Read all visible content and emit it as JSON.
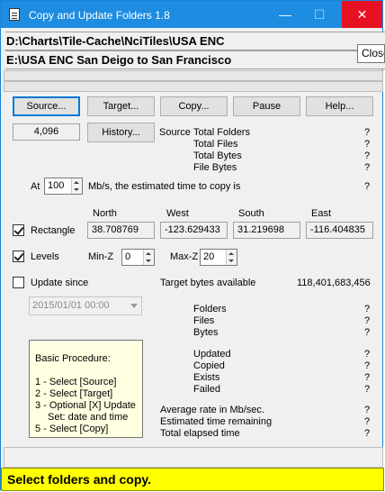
{
  "window": {
    "title": "Copy and Update Folders 1.8",
    "minimize": "—",
    "maximize": "☐",
    "close": "✕"
  },
  "paths": {
    "source": "D:\\Charts\\Tile-Cache\\NciTiles\\USA ENC",
    "target": "E:\\USA ENC San Deigo to San Francisco"
  },
  "tooltip": "Close",
  "buttons": {
    "source": "Source...",
    "target": "Target...",
    "copy": "Copy...",
    "pause": "Pause",
    "help": "Help...",
    "history": "History..."
  },
  "history_count": "4,096",
  "source_info": {
    "header": "Source",
    "labels": [
      "Total Folders",
      "Total Files",
      "Total Bytes",
      "File Bytes"
    ],
    "values": [
      "?",
      "?",
      "?",
      "?"
    ]
  },
  "rate": {
    "prefix": "At",
    "value": "100",
    "suffix": "Mb/s, the estimated time to copy is",
    "result": "?"
  },
  "rectangle": {
    "label": "Rectangle",
    "checked": true,
    "headers": [
      "North",
      "West",
      "South",
      "East"
    ],
    "values": [
      "38.708769",
      "-123.629433",
      "31.219698",
      "-116.404835"
    ]
  },
  "levels": {
    "label": "Levels",
    "checked": true,
    "min_label": "Min-Z",
    "min_value": "0",
    "max_label": "Max-Z",
    "max_value": "20"
  },
  "update_since": {
    "label": "Update since",
    "checked": false,
    "date": "2015/01/01 00:00"
  },
  "target_bytes": {
    "label": "Target bytes available",
    "value": "118,401,683,456"
  },
  "counts1": {
    "labels": [
      "Folders",
      "Files",
      "Bytes"
    ],
    "values": [
      "?",
      "?",
      "?"
    ]
  },
  "counts2": {
    "labels": [
      "Updated",
      "Copied",
      "Exists",
      "Failed"
    ],
    "values": [
      "?",
      "?",
      "?",
      "?"
    ]
  },
  "stats": {
    "labels": [
      "Average rate in Mb/sec.",
      "Estimated time remaining",
      "Total elapsed time"
    ],
    "values": [
      "?",
      "?",
      "?"
    ]
  },
  "procedure": {
    "title": "Basic Procedure:",
    "steps": [
      "1 - Select [Source]",
      "2 - Select [Target]",
      "3 - Optional [X] Update",
      "Set: date and time",
      "5 - Select [Copy]"
    ]
  },
  "status": "Select folders and copy."
}
